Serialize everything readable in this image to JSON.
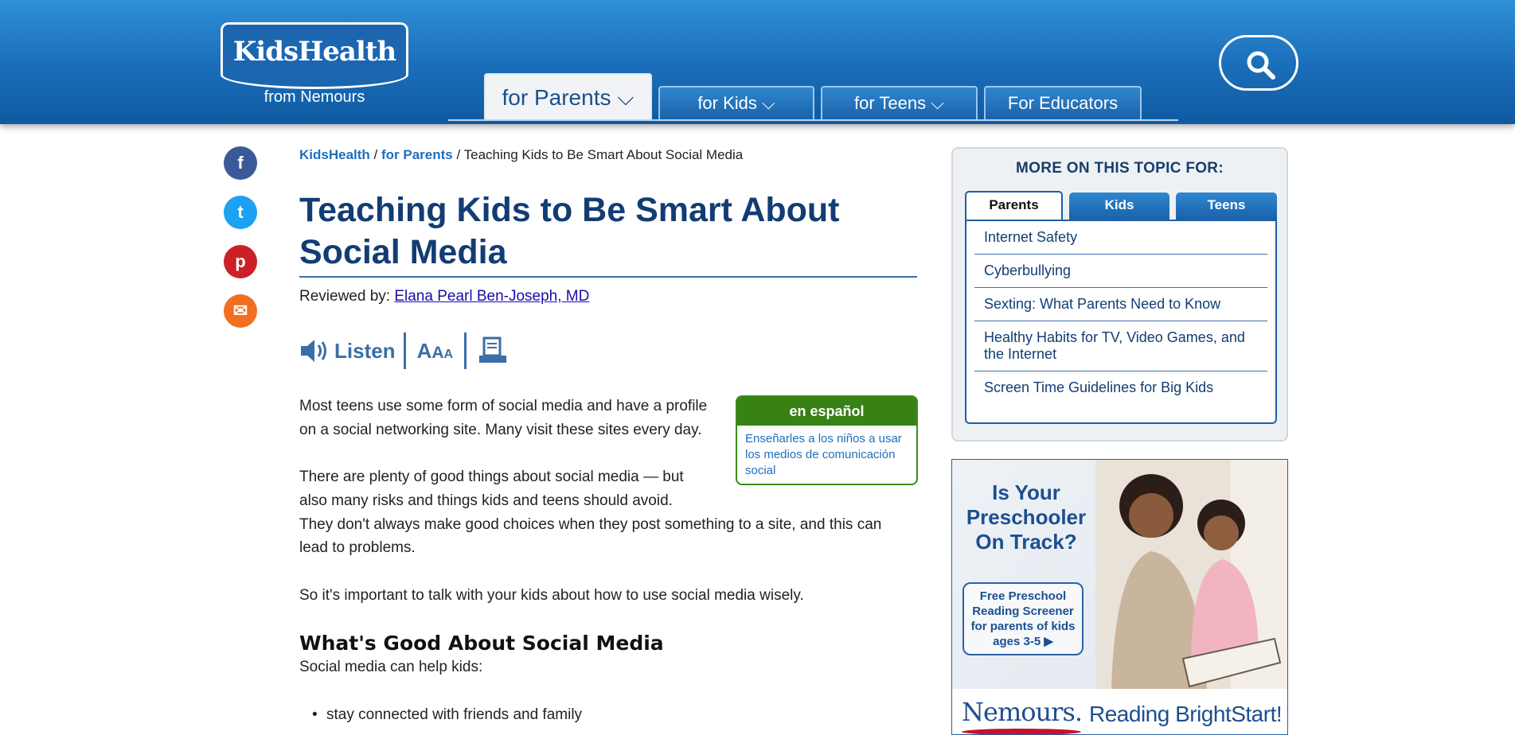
{
  "header": {
    "logo_main": "KidsHealth",
    "logo_sub": "from Nemours",
    "nav": [
      {
        "label": "for Parents ⌵"
      },
      {
        "label": "for Kids ⌵"
      },
      {
        "label": "for Teens ⌵"
      },
      {
        "label": "For Educators"
      }
    ]
  },
  "share": [
    {
      "name": "facebook",
      "glyph": "f",
      "color": "#3b5998"
    },
    {
      "name": "twitter",
      "glyph": "t",
      "color": "#1da1f2"
    },
    {
      "name": "pinterest",
      "glyph": "p",
      "color": "#cb2027"
    },
    {
      "name": "email",
      "glyph": "✉",
      "color": "#f26f21"
    }
  ],
  "breadcrumb": {
    "home": "KidsHealth",
    "section": "for Parents",
    "current": "Teaching Kids to Be Smart About Social Media",
    "sep": "/"
  },
  "article": {
    "title": "Teaching Kids to Be Smart About Social Media",
    "reviewed_label": "Reviewed by:",
    "reviewer": "Elana Pearl Ben-Joseph, MD",
    "listen": "Listen",
    "p1_l1": "Most teens use some form of social media and have a profile",
    "p1_l2": "on a social networking site. Many visit these sites every day.",
    "p2_l1": "There are plenty of good things about social media — but",
    "p2_l2": "also many risks and things kids and teens should avoid.",
    "p2_l3": "They don't always make good choices when they post something to a site, and this can",
    "p2_l4": "lead to problems.",
    "p3": "So it's important to talk with your kids about how to use social media wisely.",
    "h2": "What's Good About Social Media",
    "p4": "Social media can help kids:",
    "bullets": [
      "stay connected with friends and family"
    ]
  },
  "espanol": {
    "title": "en español",
    "link": "Enseñarles a los niños a usar los medios de comunicación social"
  },
  "sidebar": {
    "title": "MORE ON THIS TOPIC FOR:",
    "tabs": [
      "Parents",
      "Kids",
      "Teens"
    ],
    "items": [
      "Internet Safety",
      "Cyberbullying",
      "Sexting: What Parents Need to Know",
      "Healthy Habits for TV, Video Games, and the Internet",
      "Screen Time Guidelines for Big Kids"
    ]
  },
  "ad": {
    "headline": "Is Your Preschooler On Track?",
    "badge": "Free Preschool Reading Screener for parents of kids ages 3-5 ▶",
    "brand": "Nemours.",
    "tagline": "Reading BrightStart!"
  },
  "colors": {
    "header_blue": "#1a6db8",
    "title_navy": "#123d73",
    "link_blue": "#1f6fbb",
    "espanol_green": "#378115"
  }
}
